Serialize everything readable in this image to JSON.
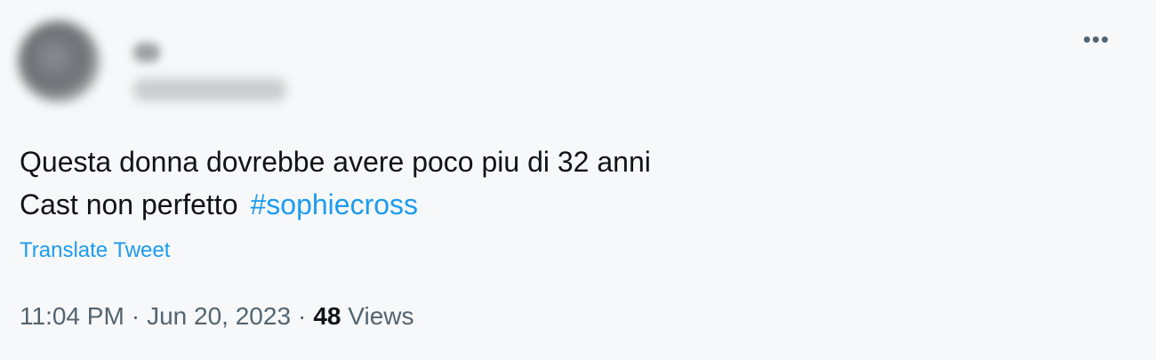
{
  "tweet": {
    "menu_icon": "more-horizontal-icon",
    "text_line_1": "Questa donna dovrebbe avere poco piu di 32 anni",
    "text_line_2": "Cast non perfetto",
    "hashtag": "#sophiecross",
    "translate_label": "Translate Tweet",
    "time": "11:04 PM",
    "date": "Jun 20, 2023",
    "separator": "·",
    "views_count": "48",
    "views_label": "Views"
  },
  "colors": {
    "link": "#1d9bf0",
    "text": "#0f1419",
    "muted": "#536471"
  }
}
